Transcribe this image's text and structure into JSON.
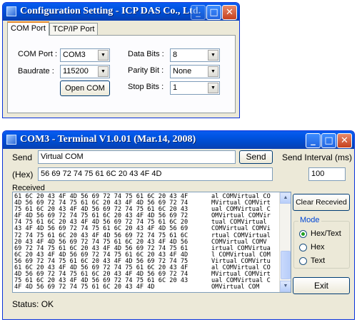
{
  "config_window": {
    "title": "Configuration Setting - ICP DAS Co., Ltd.",
    "tabs": [
      "COM Port",
      "TCP/IP Port"
    ],
    "com_port_label": "COM Port :",
    "com_port_value": "COM3",
    "baudrate_label": "Baudrate :",
    "baudrate_value": "115200",
    "data_bits_label": "Data Bits :",
    "data_bits_value": "8",
    "parity_label": "Parity Bit :",
    "parity_value": "None",
    "stop_bits_label": "Stop Bits :",
    "stop_bits_value": "1",
    "open_button": "Open COM"
  },
  "terminal_window": {
    "title": "COM3 - Terminal V1.0.01 (Mar.14, 2008)",
    "send_label": "Send",
    "send_value": "Virtual COM",
    "send_button": "Send",
    "hex_label": "(Hex)",
    "hex_value": "56 69 72 74 75 61 6C 20 43 4F 4D",
    "interval_label": "Send Interval (ms)",
    "interval_value": "100",
    "received_label": "Received",
    "received_hex": [
      "61 6C 20 43 4F 4D 56 69 72 74 75 61 6C 20 43 4F",
      "4D 56 69 72 74 75 61 6C 20 43 4F 4D 56 69 72 74",
      "75 61 6C 20 43 4F 4D 56 69 72 74 75 61 6C 20 43",
      "4F 4D 56 69 72 74 75 61 6C 20 43 4F 4D 56 69 72",
      "74 75 61 6C 20 43 4F 4D 56 69 72 74 75 61 6C 20",
      "43 4F 4D 56 69 72 74 75 61 6C 20 43 4F 4D 56 69",
      "72 74 75 61 6C 20 43 4F 4D 56 69 72 74 75 61 6C",
      "20 43 4F 4D 56 69 72 74 75 61 6C 20 43 4F 4D 56",
      "69 72 74 75 61 6C 20 43 4F 4D 56 69 72 74 75 61",
      "6C 20 43 4F 4D 56 69 72 74 75 61 6C 20 43 4F 4D",
      "56 69 72 74 75 61 6C 20 43 4F 4D 56 69 72 74 75",
      "61 6C 20 43 4F 4D 56 69 72 74 75 61 6C 20 43 4F",
      "4D 56 69 72 74 75 61 6C 20 43 4F 4D 56 69 72 74",
      "75 61 6C 20 43 4F 4D 56 69 72 74 75 61 6C 20 43",
      "4F 4D 56 69 72 74 75 61 6C 20 43 4F 4D"
    ],
    "received_text": [
      "al COMVirtual CO",
      "MVirtual COMVirt",
      "ual COMVirtual C",
      "OMVirtual COMVir",
      "tual COMVirtual",
      "COMVirtual COMVi",
      "rtual COMVirtual",
      "COMVirtual COMV",
      "irtual COMVirtua",
      "l COMVirtual COM",
      "Virtual COMVirtu",
      "al COMVirtual CO",
      "MVirtual COMVirt",
      "ual COMVirtual C",
      "OMVirtual COM"
    ],
    "clear_button": "Clear Recevied",
    "mode_label": "Mode",
    "mode_options": [
      "Hex/Text",
      "Hex",
      "Text"
    ],
    "mode_selected": "Hex/Text",
    "exit_button": "Exit",
    "status": "Status: OK"
  }
}
